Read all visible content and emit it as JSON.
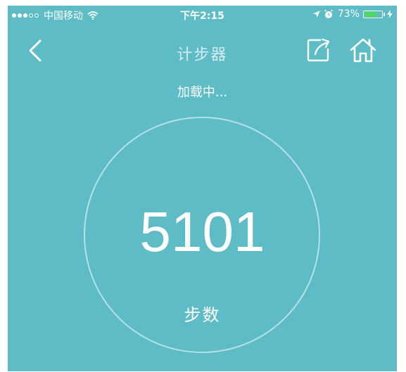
{
  "status_bar": {
    "signal_dots_full": 3,
    "signal_dots_empty": 2,
    "carrier": "中国移动",
    "wifi_icon": "wifi-icon",
    "time": "下午2:15",
    "location_icon": "location-arrow-icon",
    "alarm_icon": "alarm-icon",
    "battery_percent": "73%",
    "battery_level": 0.73,
    "charging_icon": "lightning-icon"
  },
  "nav": {
    "back_icon": "chevron-left-icon",
    "title": "计步器",
    "share_icon": "share-icon",
    "home_icon": "home-icon"
  },
  "loading_text": "加载中...",
  "steps": {
    "count": "5101",
    "unit_label": "步数"
  },
  "colors": {
    "background": "#5dbcc6",
    "text": "#ffffff",
    "battery": "#4cd964"
  }
}
